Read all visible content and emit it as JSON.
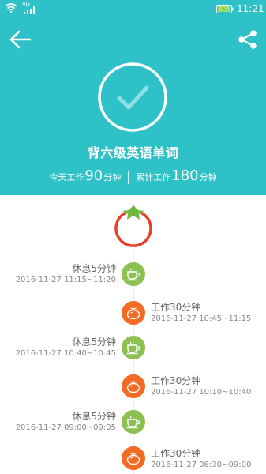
{
  "status_bar": {
    "network": "4G",
    "time": "11:21"
  },
  "header": {
    "title": "背六级英语单词",
    "today_label": "今天工作",
    "today_value": "90",
    "today_unit": "分钟",
    "total_label": "累计工作",
    "total_value": "180",
    "total_unit": "分钟"
  },
  "colors": {
    "header_bg": "#2ec1c7",
    "rest": "#8cc152",
    "work": "#f36a22",
    "tomato_ring": "#e8402a"
  },
  "timeline": [
    {
      "type": "rest",
      "title": "休息5分钟",
      "time": "2016-11-27 11:15~11:20"
    },
    {
      "type": "work",
      "title": "工作30分钟",
      "time": "2016-11-27 10:45~11:15"
    },
    {
      "type": "rest",
      "title": "休息5分钟",
      "time": "2016-11-27 10:40~10:45"
    },
    {
      "type": "work",
      "title": "工作30分钟",
      "time": "2016-11-27 10:10~10:40"
    },
    {
      "type": "rest",
      "title": "休息5分钟",
      "time": "2016-11-27 09:00~09:05"
    },
    {
      "type": "work",
      "title": "工作30分钟",
      "time": "2016-11-27 08:30~09:00"
    }
  ],
  "icons": {
    "back": "arrow-left-icon",
    "share": "share-icon",
    "check": "check-circle-icon",
    "tomato": "tomato-icon",
    "rest": "coffee-cup-icon",
    "work": "tomato-icon"
  }
}
